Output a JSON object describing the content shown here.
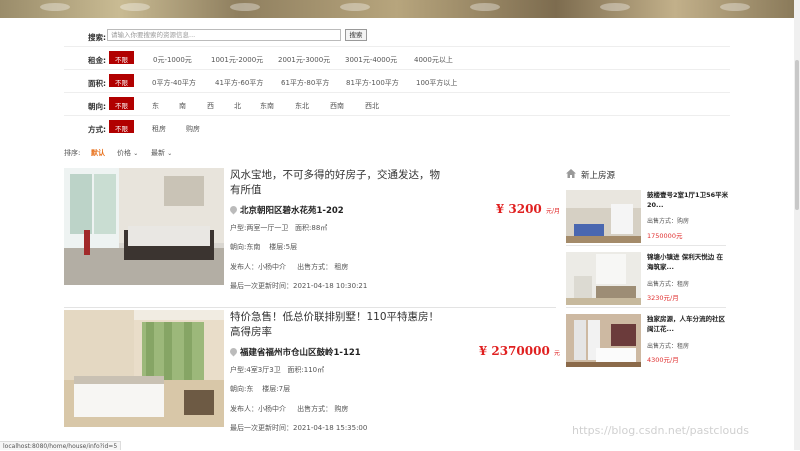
{
  "search": {
    "label": "搜索:",
    "placeholder": "请输入你要搜索的资源信息...",
    "button": "搜索"
  },
  "filters": [
    {
      "label": "租金:",
      "options": [
        "不限",
        "0元-1000元",
        "1001元-2000元",
        "2001元-3000元",
        "3001元-4000元",
        "4000元以上"
      ],
      "active": 0
    },
    {
      "label": "面积:",
      "options": [
        "不限",
        "0平方-40平方",
        "41平方-60平方",
        "61平方-80平方",
        "81平方-100平方",
        "100平方以上"
      ],
      "active": 0
    },
    {
      "label": "朝向:",
      "options": [
        "不限",
        "东",
        "南",
        "西",
        "北",
        "东南",
        "东北",
        "西南",
        "西北"
      ],
      "active": 0
    },
    {
      "label": "方式:",
      "options": [
        "不限",
        "租房",
        "购房"
      ],
      "active": 0
    }
  ],
  "sort": {
    "label": "排序:",
    "default": "默认",
    "price": "价格",
    "latest": "最新"
  },
  "listings": [
    {
      "title": "风水宝地，不可多得的好房子，交通发达，物有所值",
      "address": "北京朝阳区碧水花苑1-202",
      "layout": "户型:两室一厅一卫",
      "area": "面积:88㎡",
      "orientation": "朝向:东南",
      "floor": "楼层:5层",
      "publisher": "发布人：小杨中介",
      "type": "出售方式：",
      "type_value": "租房",
      "updated": "最后一次更新时间：2021-04-18 10:30:21",
      "price": "¥ 3200",
      "unit": "元/月"
    },
    {
      "title": "特价急售！低总价联排别墅！110平特惠房！高得房率",
      "address": "福建省福州市仓山区鼓岭1-121",
      "layout": "户型:4室3厅3卫",
      "area": "面积:110㎡",
      "orientation": "朝向:东",
      "floor": "楼层:7层",
      "publisher": "发布人：小杨中介",
      "type": "出售方式：",
      "type_value": "购房",
      "updated": "最后一次更新时间：2021-04-18 15:35:00",
      "price": "¥ 2370000",
      "unit": "元"
    }
  ],
  "sidebar": {
    "title": "新上房源",
    "items": [
      {
        "title": "鼓楼壹号2室1厅1卫56平米20...",
        "type": "出售方式：购房",
        "price": "1750000元"
      },
      {
        "title": "锦塘小镇进 保利天悦边 在海筑家...",
        "type": "出售方式：租房",
        "price": "3230元/月"
      },
      {
        "title": "独家房源，人车分流的社区闽江花...",
        "type": "出售方式：租房",
        "price": "4300元/月"
      }
    ]
  },
  "status_url": "localhost:8080/home/house/info?id=5",
  "watermark": "https://blog.csdn.net/pastclouds",
  "colors": {
    "accent": "#b10000",
    "price": "#e02020",
    "sort_active": "#e8711c"
  }
}
